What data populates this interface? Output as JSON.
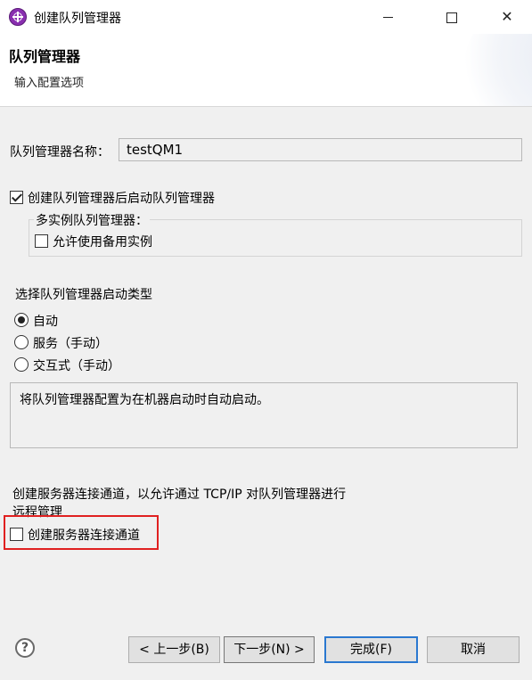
{
  "window": {
    "title": "创建队列管理器"
  },
  "header": {
    "title": "队列管理器",
    "subtitle": "输入配置选项"
  },
  "form": {
    "qm_name_label": "队列管理器名称：",
    "qm_name_value": "testQM1",
    "start_after_create_label": "创建队列管理器后启动队列管理器",
    "start_after_create_checked": true,
    "multi_instance_group_label": "多实例队列管理器：",
    "allow_standby_label": "允许使用备用实例",
    "allow_standby_checked": false,
    "startup_type_label": "选择队列管理器启动类型",
    "startup_options": [
      {
        "label": "自动",
        "selected": true
      },
      {
        "label": "服务（手动）",
        "selected": false
      },
      {
        "label": "交互式（手动）",
        "selected": false
      }
    ],
    "startup_description": "将队列管理器配置为在机器启动时自动启动。",
    "server_channel_text_line1": "创建服务器连接通道，以允许通过 TCP/IP 对队列管理器进行",
    "server_channel_text_line2": "远程管理",
    "create_server_channel_label": "创建服务器连接通道",
    "create_server_channel_checked": false
  },
  "footer": {
    "back_label": "< 上一步(B)",
    "next_label": "下一步(N) >",
    "finish_label": "完成(F)",
    "cancel_label": "取消"
  },
  "colors": {
    "highlight_border": "#e02020",
    "default_button_border": "#2a78d0",
    "app_icon": "#8a2fb0"
  }
}
